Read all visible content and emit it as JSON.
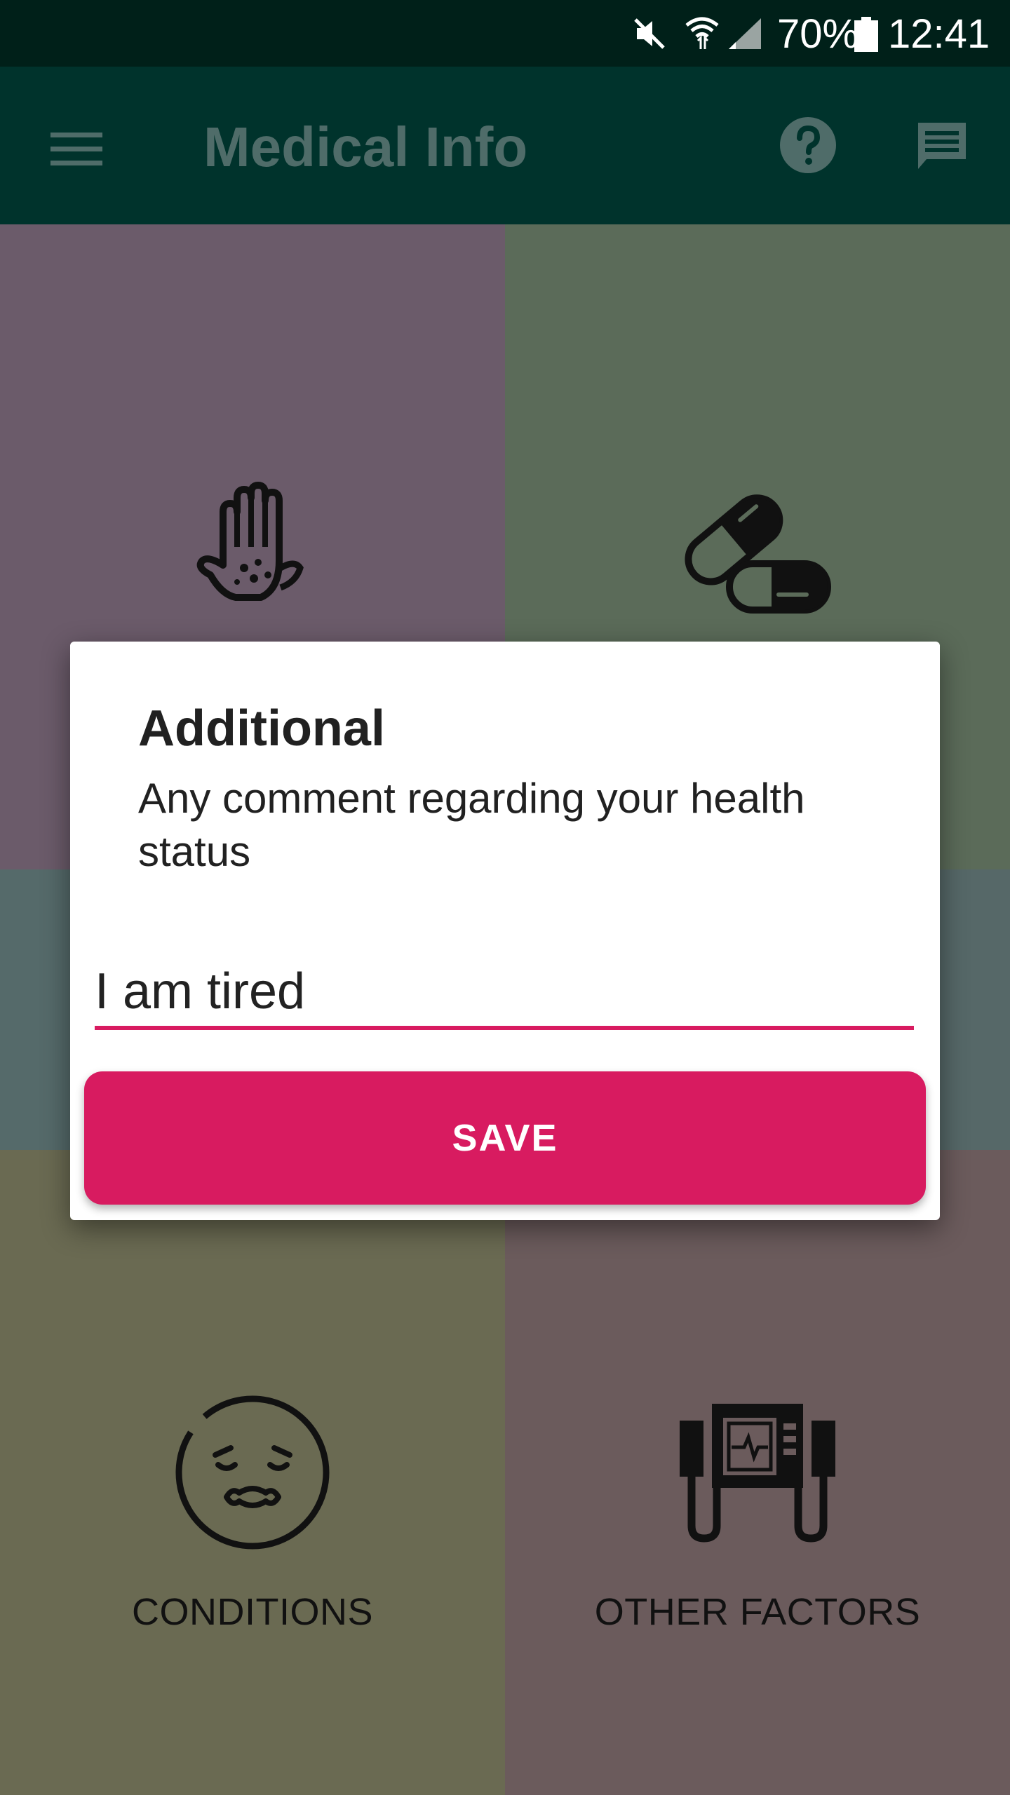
{
  "status_bar": {
    "battery": "70%",
    "time": "12:41",
    "icons": [
      "mute-icon",
      "wifi-icon",
      "signal-icon",
      "battery-icon"
    ]
  },
  "app_bar": {
    "title": "Medical Info",
    "icons": [
      "menu-icon",
      "help-icon",
      "chat-icon"
    ],
    "background": "#00332c"
  },
  "grid": {
    "tiles": [
      {
        "label": "",
        "icon": "hand-rash-icon",
        "color": "#6b5b6a"
      },
      {
        "label": "",
        "icon": "pills-icon",
        "color": "#5b6b59"
      },
      {
        "label": "",
        "icon": "",
        "color": "#556a6a"
      },
      {
        "label": "",
        "icon": "",
        "color": "#566868"
      },
      {
        "label": "CONDITIONS",
        "icon": "sick-face-icon",
        "color": "#6a6a52"
      },
      {
        "label": "OTHER FACTORS",
        "icon": "medical-device-icon",
        "color": "#6b5b5c"
      }
    ]
  },
  "dialog": {
    "title": "Additional",
    "subtitle": "Any comment regarding your health status",
    "input_value": "I am tired",
    "save_label": "SAVE",
    "accent": "#d81b60"
  }
}
